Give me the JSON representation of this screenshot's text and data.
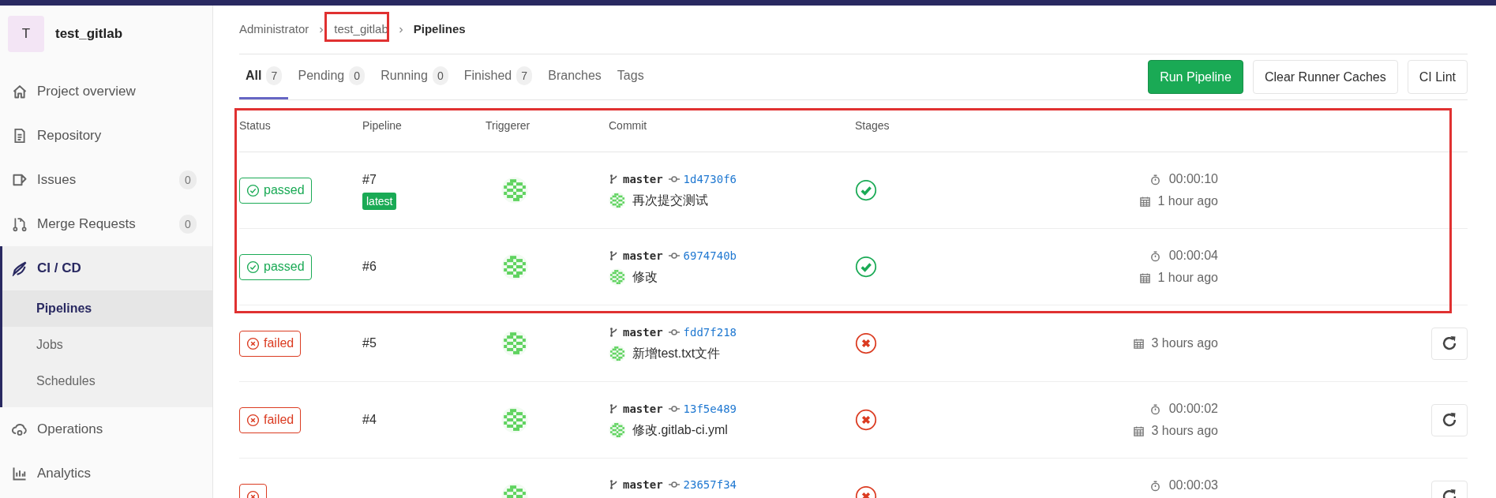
{
  "sidebar": {
    "project": {
      "initial": "T",
      "name": "test_gitlab"
    },
    "items": [
      {
        "label": "Project overview",
        "selected": false
      },
      {
        "label": "Repository",
        "selected": false
      },
      {
        "label": "Issues",
        "count": "0",
        "selected": false
      },
      {
        "label": "Merge Requests",
        "count": "0",
        "selected": false
      },
      {
        "label": "CI / CD",
        "selected": true,
        "children": [
          {
            "label": "Pipelines",
            "selected": true
          },
          {
            "label": "Jobs",
            "selected": false
          },
          {
            "label": "Schedules",
            "selected": false
          }
        ]
      },
      {
        "label": "Operations",
        "selected": false
      },
      {
        "label": "Analytics",
        "selected": false
      }
    ]
  },
  "breadcrumb": [
    "Administrator",
    "test_gitlab",
    "Pipelines"
  ],
  "tabs": [
    {
      "label": "All",
      "count": "7",
      "selected": true
    },
    {
      "label": "Pending",
      "count": "0",
      "selected": false
    },
    {
      "label": "Running",
      "count": "0",
      "selected": false
    },
    {
      "label": "Finished",
      "count": "7",
      "selected": false
    },
    {
      "label": "Branches",
      "selected": false
    },
    {
      "label": "Tags",
      "selected": false
    }
  ],
  "buttons": [
    {
      "label": "Run Pipeline",
      "kind": "primary"
    },
    {
      "label": "Clear Runner Caches",
      "kind": "default"
    },
    {
      "label": "CI Lint",
      "kind": "default"
    }
  ],
  "table": {
    "columns": [
      "Status",
      "Pipeline",
      "Triggerer",
      "Commit",
      "Stages"
    ],
    "rows": [
      {
        "kind": "success",
        "label": "passed",
        "pipeline": "#7",
        "badge": "latest",
        "branch": "master",
        "sha": "1d4730f6",
        "message": "再次提交测试",
        "duration": "00:00:10",
        "finished": "1 hour ago",
        "retry": false
      },
      {
        "kind": "success",
        "label": "passed",
        "pipeline": "#6",
        "branch": "master",
        "sha": "6974740b",
        "message": "修改",
        "duration": "00:00:04",
        "finished": "1 hour ago",
        "retry": false
      },
      {
        "kind": "failure",
        "label": "failed",
        "pipeline": "#5",
        "branch": "master",
        "sha": "fdd7f218",
        "message": "新增test.txt文件",
        "finished": "3 hours ago",
        "retry": true
      },
      {
        "kind": "failure",
        "label": "failed",
        "pipeline": "#4",
        "branch": "master",
        "sha": "13f5e489",
        "message": "修改.gitlab-ci.yml",
        "duration": "00:00:02",
        "finished": "3 hours ago",
        "retry": true
      },
      {
        "kind": "failure",
        "branch": "master",
        "sha": "23657f34",
        "duration": "00:00:03",
        "retry": true
      }
    ]
  }
}
